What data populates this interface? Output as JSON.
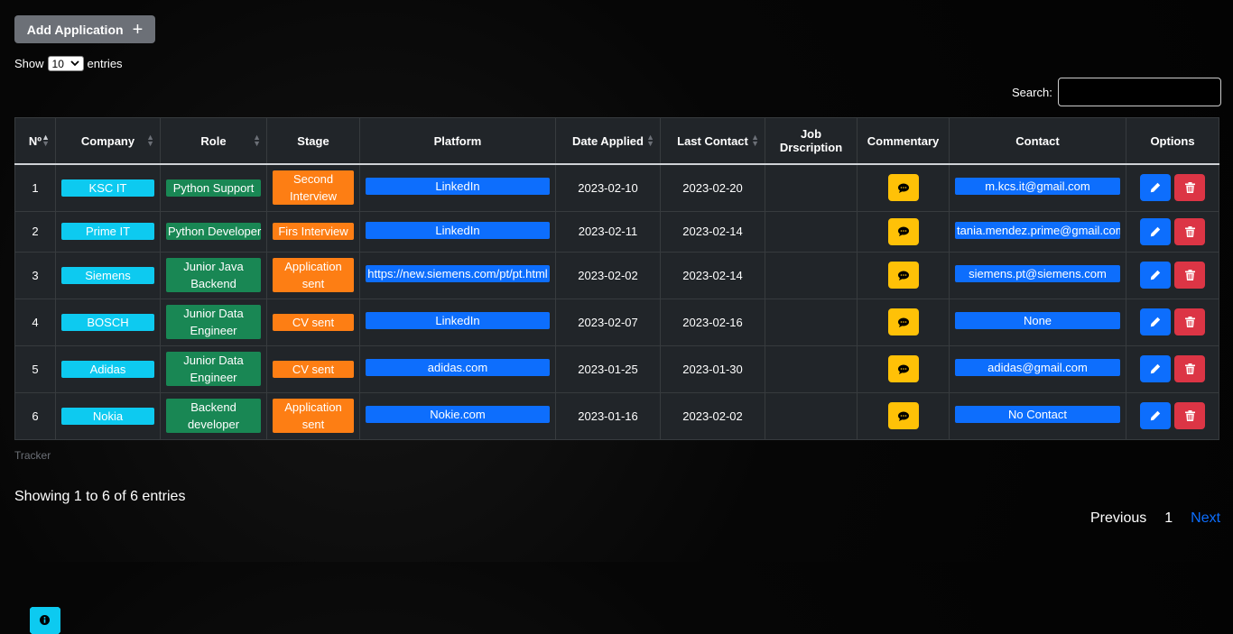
{
  "toolbar": {
    "add_label": "Add Application",
    "add_icon": "+"
  },
  "length": {
    "show": "Show",
    "value": "10",
    "entries": "entries"
  },
  "search": {
    "label": "Search:",
    "value": ""
  },
  "table": {
    "headers": [
      "Nº",
      "Company",
      "Role",
      "Stage",
      "Platform",
      "Date Applied",
      "Last Contact",
      "Job Drscription",
      "Commentary",
      "Contact",
      "Options"
    ],
    "rows": [
      {
        "n": "1",
        "company": "KSC IT",
        "role": "Python Support",
        "stage": "Second Interview",
        "platform": "LinkedIn",
        "date_applied": "2023-02-10",
        "last_contact": "2023-02-20",
        "contact": "m.kcs.it@gmail.com"
      },
      {
        "n": "2",
        "company": "Prime IT",
        "role": "Python Developer",
        "stage": "Firs Interview",
        "platform": "LinkedIn",
        "date_applied": "2023-02-11",
        "last_contact": "2023-02-14",
        "contact": "tania.mendez.prime@gmail.com"
      },
      {
        "n": "3",
        "company": "Siemens",
        "role": "Junior Java Backend",
        "stage": "Application sent",
        "platform": "https://new.siemens.com/pt/pt.html",
        "date_applied": "2023-02-02",
        "last_contact": "2023-02-14",
        "contact": "siemens.pt@siemens.com"
      },
      {
        "n": "4",
        "company": "BOSCH",
        "role": "Junior Data Engineer",
        "stage": "CV sent",
        "platform": "LinkedIn",
        "date_applied": "2023-02-07",
        "last_contact": "2023-02-16",
        "contact": "None"
      },
      {
        "n": "5",
        "company": "Adidas",
        "role": "Junior Data Engineer",
        "stage": "CV sent",
        "platform": "adidas.com",
        "date_applied": "2023-01-25",
        "last_contact": "2023-01-30",
        "contact": "adidas@gmail.com"
      },
      {
        "n": "6",
        "company": "Nokia",
        "role": "Backend developer",
        "stage": "Application sent",
        "platform": "Nokie.com",
        "date_applied": "2023-01-16",
        "last_contact": "2023-02-02",
        "contact": "No Contact"
      }
    ]
  },
  "caption": "Tracker",
  "info": "Showing 1 to 6 of 6 entries",
  "pagination": {
    "previous": "Previous",
    "current": "1",
    "next": "Next"
  },
  "colors": {
    "cyan": "#0dcaf0",
    "green": "#198754",
    "orange": "#fd7e14",
    "blue": "#0d6efd",
    "yellow": "#ffc107",
    "red": "#dc3545",
    "table_bg": "#212529"
  },
  "icons": {
    "job_description": "info-icon",
    "commentary": "comment-icon",
    "edit": "pencil-icon",
    "delete": "trash-icon",
    "sort": "sort-icon"
  }
}
